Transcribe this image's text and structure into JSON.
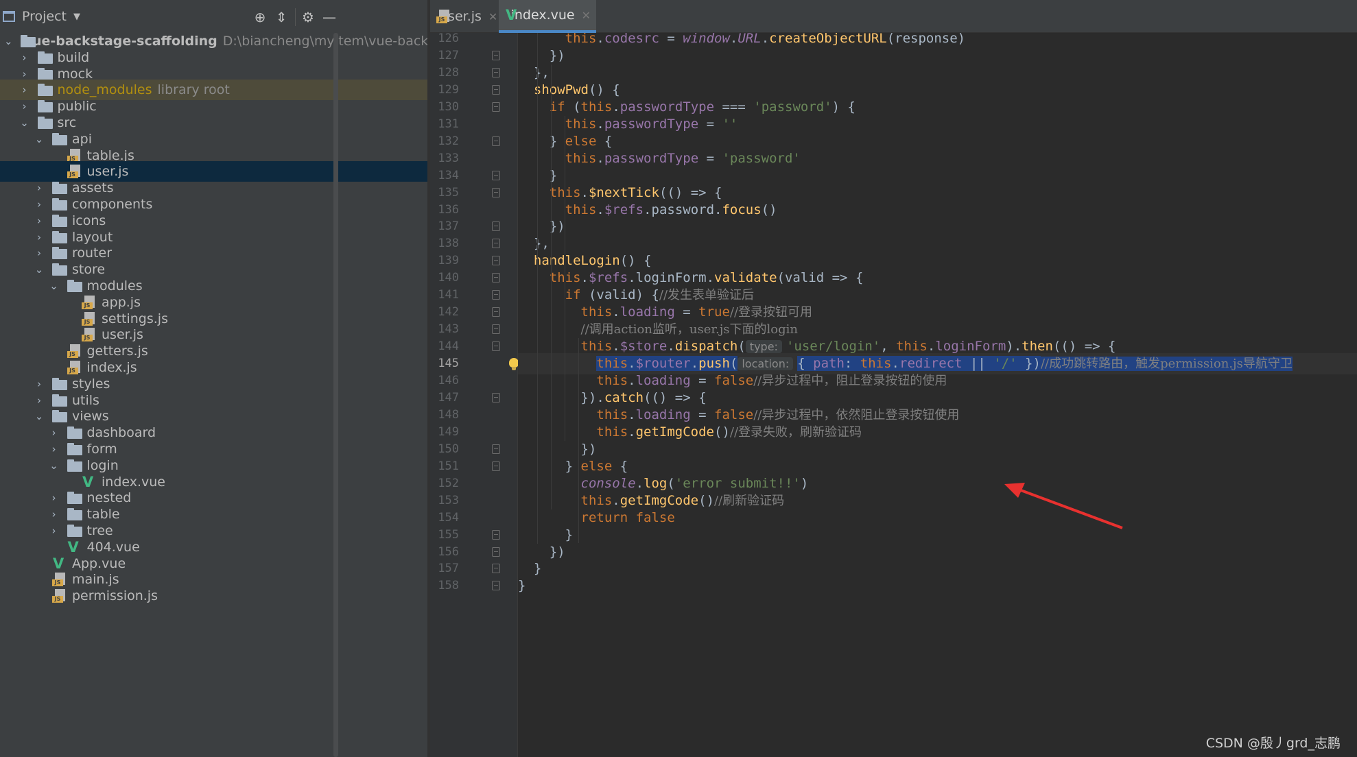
{
  "project_panel": {
    "title": "Project",
    "tree": [
      {
        "label": "vue-backstage-scaffolding",
        "path": "D:\\biancheng\\myItem\\vue-backstage",
        "depth": 0,
        "type": "folder",
        "expanded": true,
        "root": true
      },
      {
        "label": "build",
        "depth": 1,
        "type": "folder",
        "expanded": false
      },
      {
        "label": "mock",
        "depth": 1,
        "type": "folder",
        "expanded": false
      },
      {
        "label": "node_modules",
        "path": "library root",
        "depth": 1,
        "type": "folder",
        "expanded": false,
        "library": true
      },
      {
        "label": "public",
        "depth": 1,
        "type": "folder",
        "expanded": false
      },
      {
        "label": "src",
        "depth": 1,
        "type": "folder",
        "expanded": true
      },
      {
        "label": "api",
        "depth": 2,
        "type": "folder",
        "expanded": true
      },
      {
        "label": "table.js",
        "depth": 3,
        "type": "js"
      },
      {
        "label": "user.js",
        "depth": 3,
        "type": "js",
        "selected": true
      },
      {
        "label": "assets",
        "depth": 2,
        "type": "folder",
        "expanded": false
      },
      {
        "label": "components",
        "depth": 2,
        "type": "folder",
        "expanded": false
      },
      {
        "label": "icons",
        "depth": 2,
        "type": "folder",
        "expanded": false
      },
      {
        "label": "layout",
        "depth": 2,
        "type": "folder",
        "expanded": false
      },
      {
        "label": "router",
        "depth": 2,
        "type": "folder",
        "expanded": false
      },
      {
        "label": "store",
        "depth": 2,
        "type": "folder",
        "expanded": true
      },
      {
        "label": "modules",
        "depth": 3,
        "type": "folder",
        "expanded": true
      },
      {
        "label": "app.js",
        "depth": 4,
        "type": "js"
      },
      {
        "label": "settings.js",
        "depth": 4,
        "type": "js"
      },
      {
        "label": "user.js",
        "depth": 4,
        "type": "js"
      },
      {
        "label": "getters.js",
        "depth": 3,
        "type": "js"
      },
      {
        "label": "index.js",
        "depth": 3,
        "type": "js"
      },
      {
        "label": "styles",
        "depth": 2,
        "type": "folder",
        "expanded": false
      },
      {
        "label": "utils",
        "depth": 2,
        "type": "folder",
        "expanded": false
      },
      {
        "label": "views",
        "depth": 2,
        "type": "folder",
        "expanded": true
      },
      {
        "label": "dashboard",
        "depth": 3,
        "type": "folder",
        "expanded": false
      },
      {
        "label": "form",
        "depth": 3,
        "type": "folder",
        "expanded": false
      },
      {
        "label": "login",
        "depth": 3,
        "type": "folder",
        "expanded": true
      },
      {
        "label": "index.vue",
        "depth": 4,
        "type": "vue"
      },
      {
        "label": "nested",
        "depth": 3,
        "type": "folder",
        "expanded": false
      },
      {
        "label": "table",
        "depth": 3,
        "type": "folder",
        "expanded": false
      },
      {
        "label": "tree",
        "depth": 3,
        "type": "folder",
        "expanded": false
      },
      {
        "label": "404.vue",
        "depth": 3,
        "type": "vue"
      },
      {
        "label": "App.vue",
        "depth": 2,
        "type": "vue"
      },
      {
        "label": "main.js",
        "depth": 2,
        "type": "js"
      },
      {
        "label": "permission.js",
        "depth": 2,
        "type": "js"
      }
    ]
  },
  "tabs": [
    {
      "label": "user.js",
      "type": "js",
      "active": false
    },
    {
      "label": "index.vue",
      "type": "vue",
      "active": true
    }
  ],
  "editor": {
    "current_line": 145,
    "lines": [
      {
        "n": 126,
        "fold": false,
        "segs": [
          [
            "      ",
            ""
          ],
          [
            "this",
            "k"
          ],
          [
            ".",
            ""
          ],
          [
            "codesrc",
            "p"
          ],
          [
            " = ",
            ""
          ],
          [
            "window",
            "pi"
          ],
          [
            ".",
            ""
          ],
          [
            "URL",
            "pi"
          ],
          [
            ".",
            ""
          ],
          [
            "createObjectURL",
            "f"
          ],
          [
            "(response)",
            ""
          ]
        ]
      },
      {
        "n": 127,
        "fold": true,
        "segs": [
          [
            "    })",
            ""
          ]
        ]
      },
      {
        "n": 128,
        "fold": true,
        "segs": [
          [
            "  },",
            ""
          ]
        ]
      },
      {
        "n": 129,
        "fold": true,
        "segs": [
          [
            "  ",
            ""
          ],
          [
            "showPwd",
            "f"
          ],
          [
            "() {",
            ""
          ]
        ]
      },
      {
        "n": 130,
        "fold": true,
        "segs": [
          [
            "    ",
            ""
          ],
          [
            "if",
            "k"
          ],
          [
            " (",
            ""
          ],
          [
            "this",
            "k"
          ],
          [
            ".",
            ""
          ],
          [
            "passwordType",
            "p"
          ],
          [
            " === ",
            ""
          ],
          [
            "'password'",
            "s"
          ],
          [
            ") {",
            ""
          ]
        ]
      },
      {
        "n": 131,
        "fold": false,
        "segs": [
          [
            "      ",
            ""
          ],
          [
            "this",
            "k"
          ],
          [
            ".",
            ""
          ],
          [
            "passwordType",
            "p"
          ],
          [
            " = ",
            ""
          ],
          [
            "''",
            "s"
          ]
        ]
      },
      {
        "n": 132,
        "fold": true,
        "segs": [
          [
            "    } ",
            ""
          ],
          [
            "else",
            "k"
          ],
          [
            " {",
            ""
          ]
        ]
      },
      {
        "n": 133,
        "fold": false,
        "segs": [
          [
            "      ",
            ""
          ],
          [
            "this",
            "k"
          ],
          [
            ".",
            ""
          ],
          [
            "passwordType",
            "p"
          ],
          [
            " = ",
            ""
          ],
          [
            "'password'",
            "s"
          ]
        ]
      },
      {
        "n": 134,
        "fold": true,
        "segs": [
          [
            "    }",
            ""
          ]
        ]
      },
      {
        "n": 135,
        "fold": true,
        "segs": [
          [
            "    ",
            ""
          ],
          [
            "this",
            "k"
          ],
          [
            ".",
            ""
          ],
          [
            "$nextTick",
            "f"
          ],
          [
            "(() => {",
            ""
          ]
        ]
      },
      {
        "n": 136,
        "fold": false,
        "segs": [
          [
            "      ",
            ""
          ],
          [
            "this",
            "k"
          ],
          [
            ".",
            ""
          ],
          [
            "$refs",
            "p"
          ],
          [
            ".password.",
            ""
          ],
          [
            "focus",
            "f"
          ],
          [
            "()",
            ""
          ]
        ]
      },
      {
        "n": 137,
        "fold": true,
        "segs": [
          [
            "    })",
            ""
          ]
        ]
      },
      {
        "n": 138,
        "fold": true,
        "segs": [
          [
            "  },",
            ""
          ]
        ]
      },
      {
        "n": 139,
        "fold": true,
        "segs": [
          [
            "  ",
            ""
          ],
          [
            "handleLogin",
            "f"
          ],
          [
            "() {",
            ""
          ]
        ]
      },
      {
        "n": 140,
        "fold": true,
        "segs": [
          [
            "    ",
            ""
          ],
          [
            "this",
            "k"
          ],
          [
            ".",
            ""
          ],
          [
            "$refs",
            "p"
          ],
          [
            ".loginForm.",
            ""
          ],
          [
            "validate",
            "f"
          ],
          [
            "(valid => {",
            ""
          ]
        ]
      },
      {
        "n": 141,
        "fold": true,
        "segs": [
          [
            "      ",
            ""
          ],
          [
            "if",
            "k"
          ],
          [
            " (valid) {",
            ""
          ],
          [
            "//发生表单验证后",
            "c"
          ]
        ]
      },
      {
        "n": 142,
        "fold": true,
        "segs": [
          [
            "        ",
            ""
          ],
          [
            "this",
            "k"
          ],
          [
            ".",
            ""
          ],
          [
            "loading",
            "p"
          ],
          [
            " = ",
            ""
          ],
          [
            "true",
            "k"
          ],
          [
            "//登录按钮可用",
            "c"
          ]
        ]
      },
      {
        "n": 143,
        "fold": true,
        "segs": [
          [
            "        ",
            ""
          ],
          [
            "//调用action监听，user.js下面的login",
            "c"
          ]
        ]
      },
      {
        "n": 144,
        "fold": true,
        "segs": [
          [
            "        ",
            ""
          ],
          [
            "this",
            "k"
          ],
          [
            ".",
            ""
          ],
          [
            "$store",
            "p"
          ],
          [
            ".",
            ""
          ],
          [
            "dispatch",
            "f"
          ],
          [
            "(",
            ""
          ],
          [
            "type:",
            "hint"
          ],
          [
            "'user/login'",
            "s"
          ],
          [
            ", ",
            ""
          ],
          [
            "this",
            "k"
          ],
          [
            ".",
            ""
          ],
          [
            "loginForm",
            "p"
          ],
          [
            ").",
            ""
          ],
          [
            "then",
            "f"
          ],
          [
            "(() => {",
            ""
          ]
        ]
      },
      {
        "n": 145,
        "fold": false,
        "bulb": true,
        "caret": true,
        "segs": [
          [
            "          ",
            ""
          ],
          [
            "this",
            "k sel"
          ],
          [
            ".",
            "sel"
          ],
          [
            "$router",
            "p sel"
          ],
          [
            ".",
            "sel"
          ],
          [
            "push",
            "f sel"
          ],
          [
            "(",
            "sel"
          ],
          [
            "location:",
            "hint"
          ],
          [
            "{ ",
            "sel"
          ],
          [
            "path",
            "p sel"
          ],
          [
            ": ",
            "sel"
          ],
          [
            "this",
            "k sel"
          ],
          [
            ".",
            "sel"
          ],
          [
            "redirect",
            "p sel"
          ],
          [
            " || ",
            "sel"
          ],
          [
            "'/'",
            "s sel"
          ],
          [
            " })",
            "sel"
          ],
          [
            "//成功跳转路由，触发permission.js导航守卫",
            "c sel"
          ]
        ]
      },
      {
        "n": 146,
        "fold": false,
        "segs": [
          [
            "          ",
            ""
          ],
          [
            "this",
            "k"
          ],
          [
            ".",
            ""
          ],
          [
            "loading",
            "p"
          ],
          [
            " = ",
            ""
          ],
          [
            "false",
            "k"
          ],
          [
            "//异步过程中，阻止登录按钮的使用",
            "c"
          ]
        ]
      },
      {
        "n": 147,
        "fold": true,
        "segs": [
          [
            "        }).",
            ""
          ],
          [
            "catch",
            "f"
          ],
          [
            "(() => {",
            ""
          ]
        ]
      },
      {
        "n": 148,
        "fold": false,
        "segs": [
          [
            "          ",
            ""
          ],
          [
            "this",
            "k"
          ],
          [
            ".",
            ""
          ],
          [
            "loading",
            "p"
          ],
          [
            " = ",
            ""
          ],
          [
            "false",
            "k"
          ],
          [
            "//异步过程中，依然阻止登录按钮使用",
            "c"
          ]
        ]
      },
      {
        "n": 149,
        "fold": false,
        "segs": [
          [
            "          ",
            ""
          ],
          [
            "this",
            "k"
          ],
          [
            ".",
            ""
          ],
          [
            "getImgCode",
            "f"
          ],
          [
            "()",
            ""
          ],
          [
            "//登录失败，刷新验证码",
            "c"
          ]
        ]
      },
      {
        "n": 150,
        "fold": true,
        "segs": [
          [
            "        })",
            ""
          ]
        ]
      },
      {
        "n": 151,
        "fold": true,
        "segs": [
          [
            "      } ",
            ""
          ],
          [
            "else",
            "k"
          ],
          [
            " {",
            ""
          ]
        ]
      },
      {
        "n": 152,
        "fold": false,
        "segs": [
          [
            "        ",
            ""
          ],
          [
            "console",
            "pi"
          ],
          [
            ".",
            ""
          ],
          [
            "log",
            "f"
          ],
          [
            "(",
            ""
          ],
          [
            "'error submit!!'",
            "s"
          ],
          [
            ")",
            ""
          ]
        ]
      },
      {
        "n": 153,
        "fold": false,
        "segs": [
          [
            "        ",
            ""
          ],
          [
            "this",
            "k"
          ],
          [
            ".",
            ""
          ],
          [
            "getImgCode",
            "f"
          ],
          [
            "()",
            ""
          ],
          [
            "//刷新验证码",
            "c"
          ]
        ]
      },
      {
        "n": 154,
        "fold": false,
        "segs": [
          [
            "        ",
            ""
          ],
          [
            "return false",
            "k"
          ]
        ]
      },
      {
        "n": 155,
        "fold": true,
        "segs": [
          [
            "      }",
            ""
          ]
        ]
      },
      {
        "n": 156,
        "fold": true,
        "segs": [
          [
            "    })",
            ""
          ]
        ]
      },
      {
        "n": 157,
        "fold": true,
        "segs": [
          [
            "  }",
            ""
          ]
        ]
      },
      {
        "n": 158,
        "fold": true,
        "segs": [
          [
            "}",
            ""
          ]
        ]
      }
    ]
  },
  "watermark": "CSDN @殷丿grd_志鹏",
  "colors": {
    "annotation_arrow": "#e8312f",
    "selection": "#214283",
    "accent": "#4a88c7"
  }
}
